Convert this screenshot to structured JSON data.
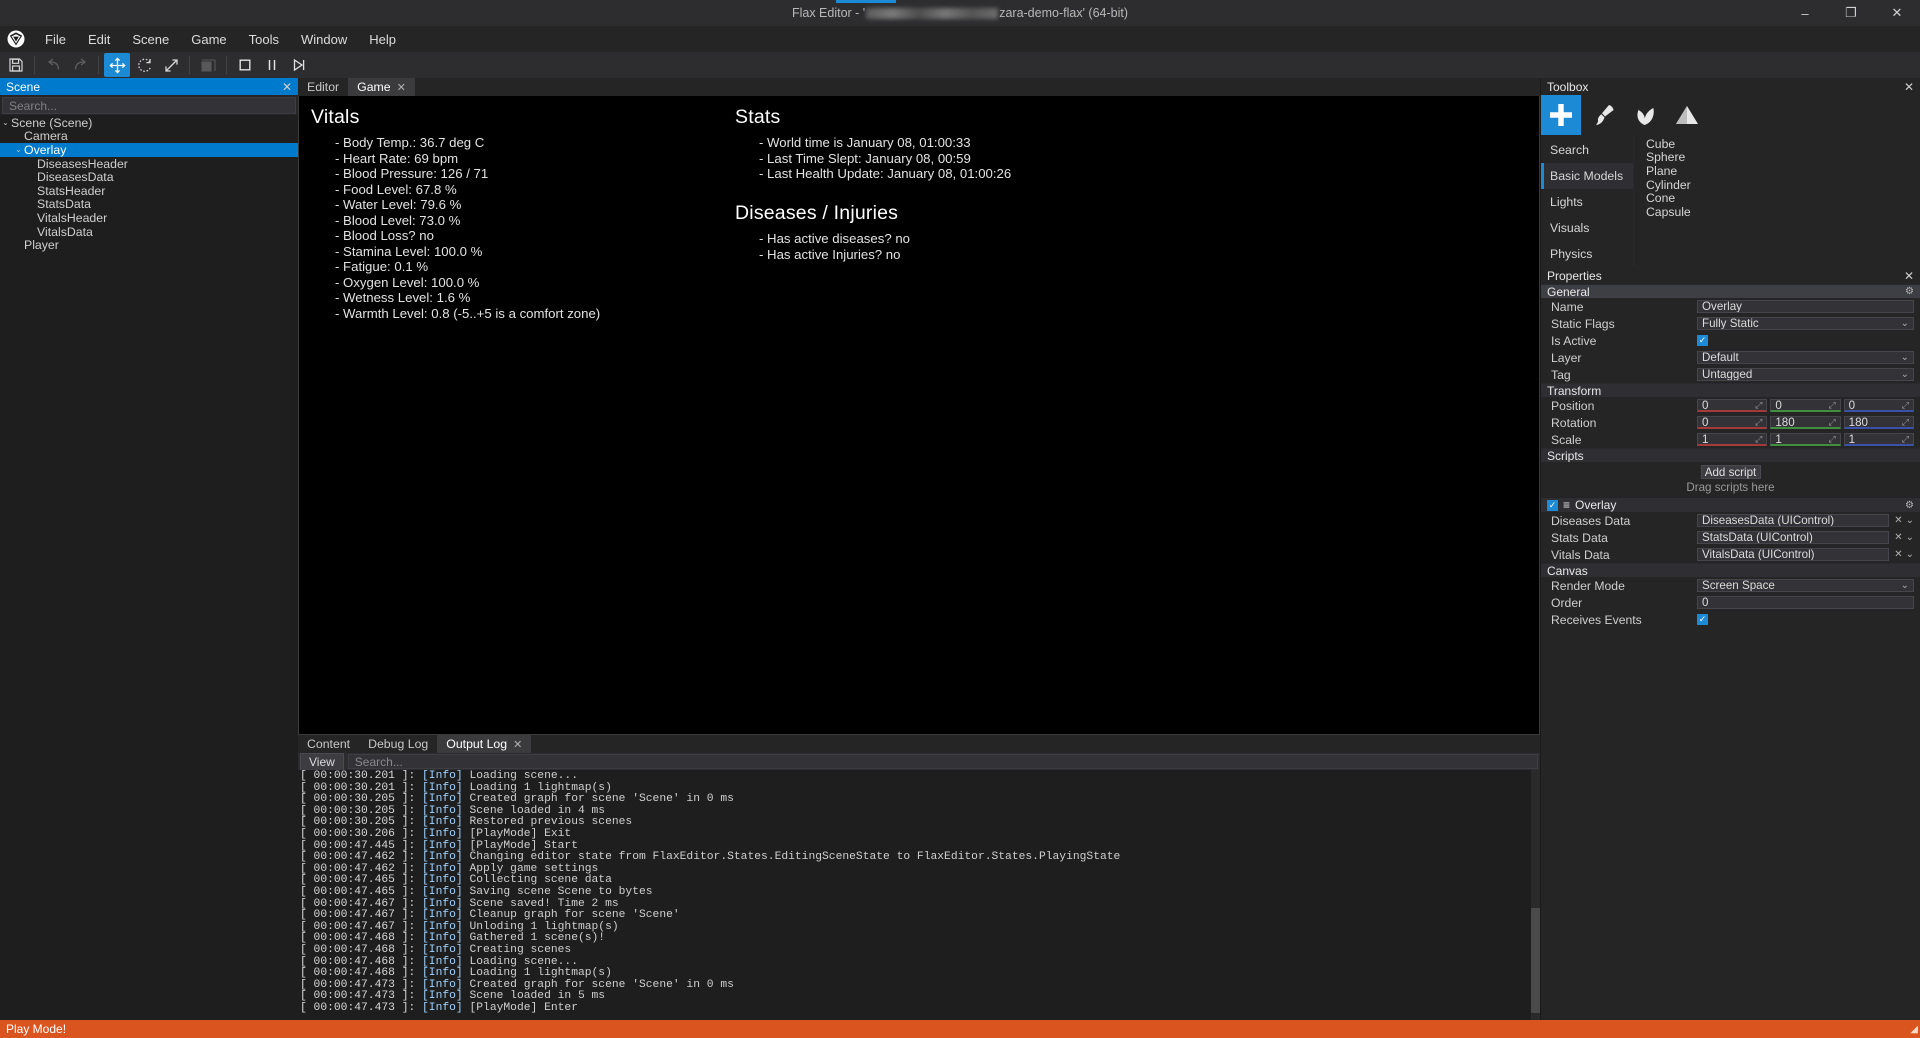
{
  "window": {
    "title_prefix": "Flax Editor - '",
    "title_suffix": "zara-demo-flax' (64-bit)",
    "minimize": "–",
    "maximize": "❐",
    "close": "✕"
  },
  "menubar": {
    "logo_name": "flax-logo",
    "items": [
      {
        "label": "File"
      },
      {
        "label": "Edit"
      },
      {
        "label": "Scene"
      },
      {
        "label": "Game"
      },
      {
        "label": "Tools"
      },
      {
        "label": "Window"
      },
      {
        "label": "Help"
      }
    ]
  },
  "toolbar": {
    "buttons": [
      {
        "name": "save-icon",
        "state": "normal"
      },
      {
        "name": "undo-icon",
        "state": "disabled"
      },
      {
        "name": "redo-icon",
        "state": "disabled"
      },
      {
        "name": "translate-gizmo-icon",
        "state": "active"
      },
      {
        "name": "rotate-gizmo-icon",
        "state": "normal"
      },
      {
        "name": "scale-gizmo-icon",
        "state": "normal"
      },
      {
        "name": "grid-snap-icon",
        "state": "disabled"
      },
      {
        "name": "stop-icon",
        "state": "normal"
      },
      {
        "name": "pause-icon",
        "state": "normal"
      },
      {
        "name": "step-frame-icon",
        "state": "normal"
      }
    ]
  },
  "scene_panel": {
    "title": "Scene",
    "close": "✕",
    "search_placeholder": "Search...",
    "tree": [
      {
        "label": "Scene (Scene)",
        "indent": 0,
        "arrow": "⌄",
        "selected": false
      },
      {
        "label": "Camera",
        "indent": 1,
        "arrow": "",
        "selected": false
      },
      {
        "label": "Overlay",
        "indent": 1,
        "arrow": "⌄",
        "selected": true
      },
      {
        "label": "DiseasesHeader",
        "indent": 2,
        "arrow": "",
        "selected": false
      },
      {
        "label": "DiseasesData",
        "indent": 2,
        "arrow": "",
        "selected": false
      },
      {
        "label": "StatsHeader",
        "indent": 2,
        "arrow": "",
        "selected": false
      },
      {
        "label": "StatsData",
        "indent": 2,
        "arrow": "",
        "selected": false
      },
      {
        "label": "VitalsHeader",
        "indent": 2,
        "arrow": "",
        "selected": false
      },
      {
        "label": "VitalsData",
        "indent": 2,
        "arrow": "",
        "selected": false
      },
      {
        "label": "Player",
        "indent": 1,
        "arrow": "",
        "selected": false
      }
    ]
  },
  "viewport_tabs": [
    {
      "label": "Editor",
      "active": false,
      "closable": false
    },
    {
      "label": "Game",
      "active": true,
      "closable": true,
      "close": "✕"
    }
  ],
  "game_overlay": {
    "vitals": {
      "heading": "Vitals",
      "lines": [
        "- Body Temp.: 36.7 deg C",
        "- Heart Rate: 69 bpm",
        "- Blood Pressure: 126 / 71",
        "- Food Level: 67.8 %",
        "- Water Level: 79.6 %",
        "- Blood Level: 73.0 %",
        "- Blood Loss? no",
        "- Stamina Level: 100.0 %",
        "- Fatigue: 0.1 %",
        "- Oxygen Level: 100.0 %",
        "- Wetness Level: 1.6 %",
        "- Warmth Level: 0.8 (-5..+5 is a comfort zone)"
      ]
    },
    "stats": {
      "heading": "Stats",
      "lines": [
        "- World time is January 08, 01:00:33",
        "- Last Time Slept: January 08, 00:59",
        "- Last Health Update: January 08, 01:00:26"
      ]
    },
    "diseases": {
      "heading": "Diseases / Injuries",
      "lines": [
        "- Has active diseases? no",
        "- Has active Injuries? no"
      ]
    }
  },
  "bottom_dock": {
    "tabs": [
      {
        "label": "Content",
        "active": false,
        "closable": false
      },
      {
        "label": "Debug Log",
        "active": false,
        "closable": false
      },
      {
        "label": "Output Log",
        "active": true,
        "closable": true,
        "close": "✕"
      }
    ],
    "view_button": "View",
    "search_placeholder": "Search...",
    "log_lines": [
      {
        "ts": "[ 00:00:30.201 ]:",
        "lvl": "[Info]",
        "msg": "Loading scene..."
      },
      {
        "ts": "[ 00:00:30.201 ]:",
        "lvl": "[Info]",
        "msg": "Loading 1 lightmap(s)"
      },
      {
        "ts": "[ 00:00:30.205 ]:",
        "lvl": "[Info]",
        "msg": "Created graph for scene 'Scene' in 0 ms"
      },
      {
        "ts": "[ 00:00:30.205 ]:",
        "lvl": "[Info]",
        "msg": "Scene loaded in 4 ms"
      },
      {
        "ts": "[ 00:00:30.205 ]:",
        "lvl": "[Info]",
        "msg": "Restored previous scenes"
      },
      {
        "ts": "[ 00:00:30.206 ]:",
        "lvl": "[Info]",
        "msg": "[PlayMode] Exit"
      },
      {
        "ts": "[ 00:00:47.445 ]:",
        "lvl": "[Info]",
        "msg": "[PlayMode] Start"
      },
      {
        "ts": "[ 00:00:47.462 ]:",
        "lvl": "[Info]",
        "msg": "Changing editor state from FlaxEditor.States.EditingSceneState to FlaxEditor.States.PlayingState"
      },
      {
        "ts": "[ 00:00:47.462 ]:",
        "lvl": "[Info]",
        "msg": "Apply game settings"
      },
      {
        "ts": "[ 00:00:47.465 ]:",
        "lvl": "[Info]",
        "msg": "Collecting scene data"
      },
      {
        "ts": "[ 00:00:47.465 ]:",
        "lvl": "[Info]",
        "msg": "Saving scene Scene to bytes"
      },
      {
        "ts": "[ 00:00:47.467 ]:",
        "lvl": "[Info]",
        "msg": "Scene saved! Time 2 ms"
      },
      {
        "ts": "[ 00:00:47.467 ]:",
        "lvl": "[Info]",
        "msg": "Cleanup graph for scene 'Scene'"
      },
      {
        "ts": "[ 00:00:47.467 ]:",
        "lvl": "[Info]",
        "msg": "Unloding 1 lightmap(s)"
      },
      {
        "ts": "[ 00:00:47.468 ]:",
        "lvl": "[Info]",
        "msg": "Gathered 1 scene(s)!"
      },
      {
        "ts": "[ 00:00:47.468 ]:",
        "lvl": "[Info]",
        "msg": "Creating scenes"
      },
      {
        "ts": "[ 00:00:47.468 ]:",
        "lvl": "[Info]",
        "msg": "Loading scene..."
      },
      {
        "ts": "[ 00:00:47.468 ]:",
        "lvl": "[Info]",
        "msg": "Loading 1 lightmap(s)"
      },
      {
        "ts": "[ 00:00:47.473 ]:",
        "lvl": "[Info]",
        "msg": "Created graph for scene 'Scene' in 0 ms"
      },
      {
        "ts": "[ 00:00:47.473 ]:",
        "lvl": "[Info]",
        "msg": "Scene loaded in 5 ms"
      },
      {
        "ts": "[ 00:00:47.473 ]:",
        "lvl": "[Info]",
        "msg": "[PlayMode] Enter"
      }
    ]
  },
  "toolbox": {
    "title": "Toolbox",
    "close": "✕",
    "icons": [
      {
        "name": "add-actor-icon",
        "active": true
      },
      {
        "name": "paint-brush-icon",
        "active": false
      },
      {
        "name": "foliage-leaf-icon",
        "active": false
      },
      {
        "name": "terrain-mountain-icon",
        "active": false
      }
    ],
    "categories": [
      {
        "label": "Search",
        "selected": false
      },
      {
        "label": "Basic Models",
        "selected": true
      },
      {
        "label": "Lights",
        "selected": false
      },
      {
        "label": "Visuals",
        "selected": false
      },
      {
        "label": "Physics",
        "selected": false
      }
    ],
    "items": [
      "Cube",
      "Sphere",
      "Plane",
      "Cylinder",
      "Cone",
      "Capsule"
    ]
  },
  "properties": {
    "title": "Properties",
    "close": "✕",
    "general": {
      "header": "General",
      "gear": "⚙",
      "rows": [
        {
          "label": "Name",
          "value": "Overlay",
          "type": "text"
        },
        {
          "label": "Static Flags",
          "value": "Fully Static",
          "type": "combo"
        },
        {
          "label": "Is Active",
          "value": "✓",
          "type": "checkbox"
        },
        {
          "label": "Layer",
          "value": "Default",
          "type": "combo"
        },
        {
          "label": "Tag",
          "value": "Untagged",
          "type": "combo"
        }
      ]
    },
    "transform": {
      "header": "Transform",
      "rows": [
        {
          "label": "Position",
          "x": "0",
          "y": "0",
          "z": "0"
        },
        {
          "label": "Rotation",
          "x": "0",
          "y": "180",
          "z": "180"
        },
        {
          "label": "Scale",
          "x": "1",
          "y": "1",
          "z": "1"
        }
      ]
    },
    "scripts": {
      "header": "Scripts",
      "add_button": "Add script",
      "drag_hint": "Drag scripts here"
    },
    "overlay_script": {
      "name": "Overlay",
      "checkbox": "✓",
      "menu_icon": "≡",
      "gear": "⚙",
      "rows": [
        {
          "label": "Diseases Data",
          "value": "DiseasesData (UIControl)"
        },
        {
          "label": "Stats Data",
          "value": "StatsData (UIControl)"
        },
        {
          "label": "Vitals Data",
          "value": "VitalsData (UIControl)"
        }
      ]
    },
    "canvas": {
      "header": "Canvas",
      "rows": [
        {
          "label": "Render Mode",
          "value": "Screen Space",
          "type": "combo"
        },
        {
          "label": "Order",
          "value": "0",
          "type": "text"
        },
        {
          "label": "Receives Events",
          "value": "✓",
          "type": "checkbox"
        }
      ]
    }
  },
  "statusbar": {
    "text": "Play Mode!"
  },
  "colors": {
    "accent": "#007acc",
    "toolbox_accent": "#1c8ad4",
    "status_orange": "#d9541f",
    "axis_x": "#a33b3b",
    "axis_y": "#3f8f3f",
    "axis_z": "#3a52a8"
  }
}
